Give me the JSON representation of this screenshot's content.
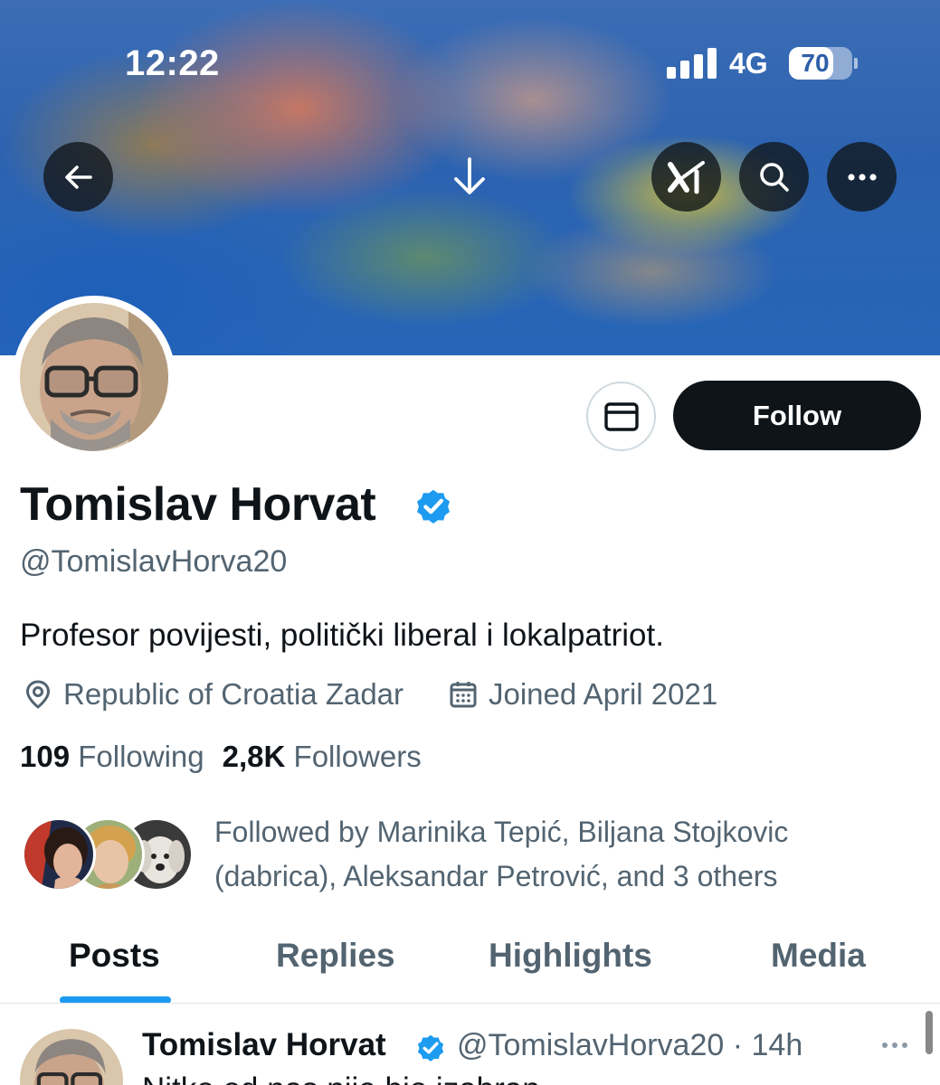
{
  "status_bar": {
    "time": "12:22",
    "network": "4G",
    "battery": "70",
    "battery_level": 0.7
  },
  "banner_actions": {
    "back_icon": "arrow-left-icon",
    "download_icon": "arrow-down-icon",
    "grok_icon": "grok-logo-icon",
    "search_icon": "search-icon",
    "more_icon": "more-horizontal-icon"
  },
  "profile": {
    "display_name": "Tomislav Horvat",
    "handle": "@TomislavHorva20",
    "bio": "Profesor povijesti, politički liberal i lokalpatriot.",
    "location": "Republic of Croatia Zadar",
    "joined": "Joined April 2021",
    "verified_color": "#1d9bf0"
  },
  "actions": {
    "message_icon": "envelope-icon",
    "follow_label": "Follow"
  },
  "stats": {
    "following_count": "109",
    "following_label": "Following",
    "followers_count": "2,8K",
    "followers_label": "Followers"
  },
  "followed_by": {
    "text": "Followed by Marinika Tepić, Biljana Stojkovic (dabrica), Aleksandar Petrović, and 3 others"
  },
  "tabs": [
    {
      "label": "Posts",
      "active": true
    },
    {
      "label": "Replies",
      "active": false
    },
    {
      "label": "Highlights",
      "active": false
    },
    {
      "label": "Media",
      "active": false
    }
  ],
  "post": {
    "author_name": "Tomislav Horvat",
    "author_handle": "@TomislavHorva20",
    "separator": "·",
    "time": "14h",
    "text": "Nitko od nas nije bio izabran"
  },
  "colors": {
    "accent": "#1d9bf0",
    "text_primary": "#0f1419",
    "text_secondary": "#536471"
  }
}
